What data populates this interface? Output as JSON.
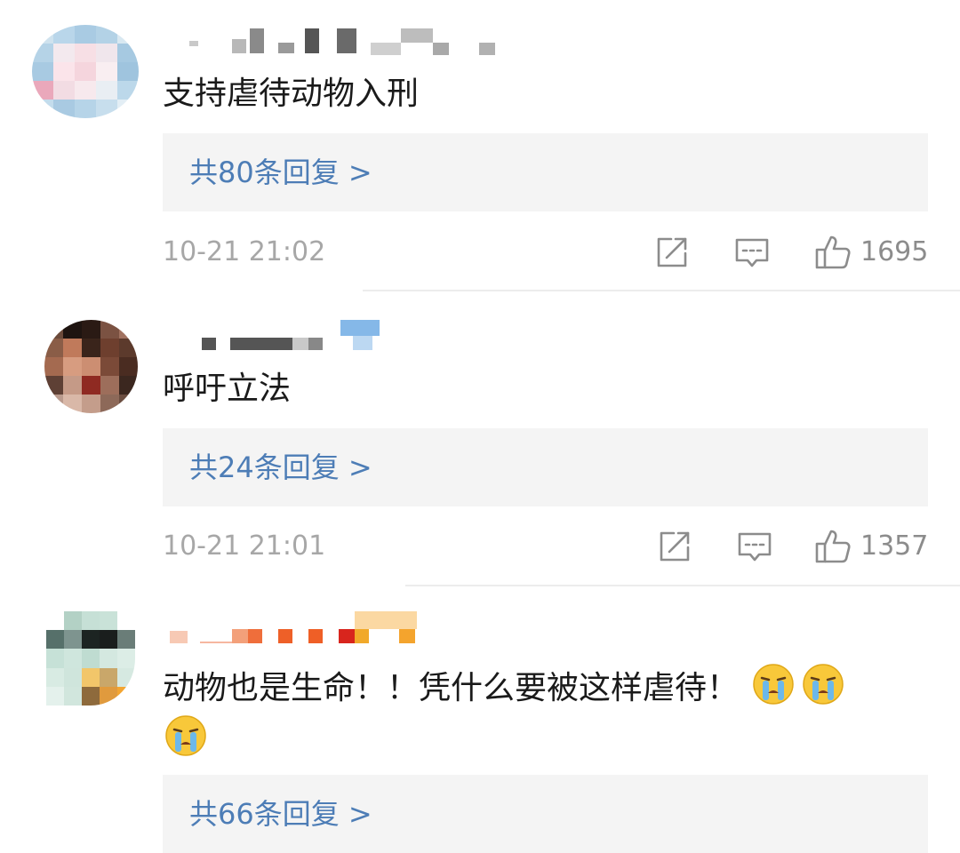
{
  "comments": [
    {
      "text": "支持虐待动物入刑",
      "replies_label": "共80条回复 >",
      "timestamp": "10-21 21:02",
      "likes": "1695"
    },
    {
      "text": "呼吁立法",
      "replies_label": "共24条回复 >",
      "timestamp": "10-21 21:01",
      "likes": "1357"
    },
    {
      "text_line1": "动物也是生命！！凭什么要被这样虐待！",
      "emoji_name": "crying-face-emoji",
      "replies_label": "共66条回复 >"
    }
  ],
  "icons": {
    "share": "share-icon",
    "comment": "comment-icon",
    "like": "thumbs-up-icon"
  },
  "colors": {
    "link": "#4d7db6",
    "meta_text": "#a7a7a7",
    "reply_box_bg": "#f4f4f4",
    "divider": "#ececec"
  }
}
